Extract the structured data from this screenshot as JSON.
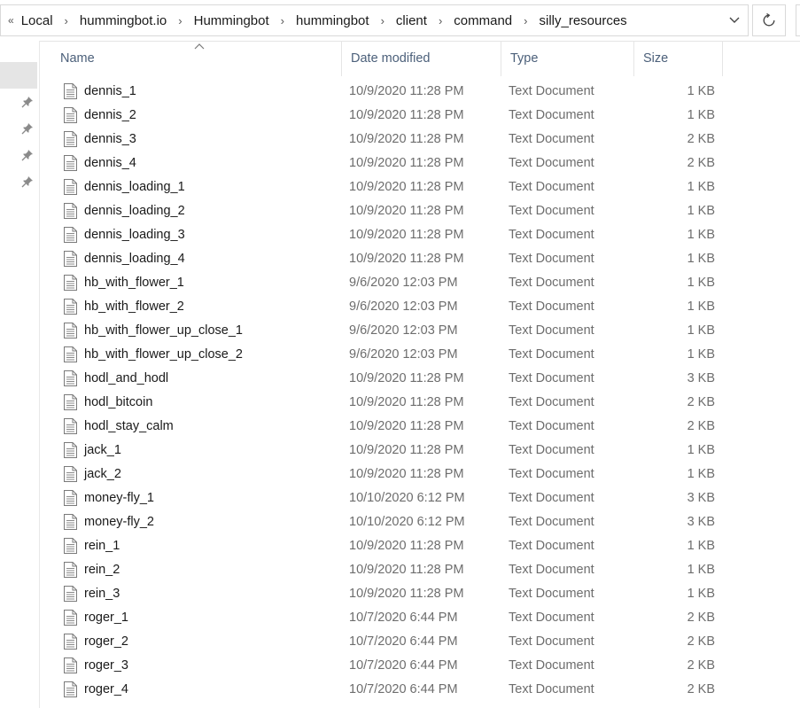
{
  "address_bar": {
    "overflow_glyph": "«",
    "segments": [
      "Local",
      "hummingbot.io",
      "Hummingbot",
      "hummingbot",
      "client",
      "command",
      "silly_resources"
    ],
    "separator": "›"
  },
  "columns": {
    "name": "Name",
    "date_modified": "Date modified",
    "type": "Type",
    "size": "Size",
    "sorted_by": "name"
  },
  "files": [
    {
      "name": "dennis_1",
      "date": "10/9/2020 11:28 PM",
      "type": "Text Document",
      "size": "1 KB"
    },
    {
      "name": "dennis_2",
      "date": "10/9/2020 11:28 PM",
      "type": "Text Document",
      "size": "1 KB"
    },
    {
      "name": "dennis_3",
      "date": "10/9/2020 11:28 PM",
      "type": "Text Document",
      "size": "2 KB"
    },
    {
      "name": "dennis_4",
      "date": "10/9/2020 11:28 PM",
      "type": "Text Document",
      "size": "2 KB"
    },
    {
      "name": "dennis_loading_1",
      "date": "10/9/2020 11:28 PM",
      "type": "Text Document",
      "size": "1 KB"
    },
    {
      "name": "dennis_loading_2",
      "date": "10/9/2020 11:28 PM",
      "type": "Text Document",
      "size": "1 KB"
    },
    {
      "name": "dennis_loading_3",
      "date": "10/9/2020 11:28 PM",
      "type": "Text Document",
      "size": "1 KB"
    },
    {
      "name": "dennis_loading_4",
      "date": "10/9/2020 11:28 PM",
      "type": "Text Document",
      "size": "1 KB"
    },
    {
      "name": "hb_with_flower_1",
      "date": "9/6/2020 12:03 PM",
      "type": "Text Document",
      "size": "1 KB"
    },
    {
      "name": "hb_with_flower_2",
      "date": "9/6/2020 12:03 PM",
      "type": "Text Document",
      "size": "1 KB"
    },
    {
      "name": "hb_with_flower_up_close_1",
      "date": "9/6/2020 12:03 PM",
      "type": "Text Document",
      "size": "1 KB"
    },
    {
      "name": "hb_with_flower_up_close_2",
      "date": "9/6/2020 12:03 PM",
      "type": "Text Document",
      "size": "1 KB"
    },
    {
      "name": "hodl_and_hodl",
      "date": "10/9/2020 11:28 PM",
      "type": "Text Document",
      "size": "3 KB"
    },
    {
      "name": "hodl_bitcoin",
      "date": "10/9/2020 11:28 PM",
      "type": "Text Document",
      "size": "2 KB"
    },
    {
      "name": "hodl_stay_calm",
      "date": "10/9/2020 11:28 PM",
      "type": "Text Document",
      "size": "2 KB"
    },
    {
      "name": "jack_1",
      "date": "10/9/2020 11:28 PM",
      "type": "Text Document",
      "size": "1 KB"
    },
    {
      "name": "jack_2",
      "date": "10/9/2020 11:28 PM",
      "type": "Text Document",
      "size": "1 KB"
    },
    {
      "name": "money-fly_1",
      "date": "10/10/2020 6:12 PM",
      "type": "Text Document",
      "size": "3 KB"
    },
    {
      "name": "money-fly_2",
      "date": "10/10/2020 6:12 PM",
      "type": "Text Document",
      "size": "3 KB"
    },
    {
      "name": "rein_1",
      "date": "10/9/2020 11:28 PM",
      "type": "Text Document",
      "size": "1 KB"
    },
    {
      "name": "rein_2",
      "date": "10/9/2020 11:28 PM",
      "type": "Text Document",
      "size": "1 KB"
    },
    {
      "name": "rein_3",
      "date": "10/9/2020 11:28 PM",
      "type": "Text Document",
      "size": "1 KB"
    },
    {
      "name": "roger_1",
      "date": "10/7/2020 6:44 PM",
      "type": "Text Document",
      "size": "2 KB"
    },
    {
      "name": "roger_2",
      "date": "10/7/2020 6:44 PM",
      "type": "Text Document",
      "size": "2 KB"
    },
    {
      "name": "roger_3",
      "date": "10/7/2020 6:44 PM",
      "type": "Text Document",
      "size": "2 KB"
    },
    {
      "name": "roger_4",
      "date": "10/7/2020 6:44 PM",
      "type": "Text Document",
      "size": "2 KB"
    }
  ],
  "icons": {
    "file": "text-document-icon",
    "pin": "pin-icon",
    "refresh": "refresh-icon",
    "dropdown": "chevron-down-icon"
  }
}
